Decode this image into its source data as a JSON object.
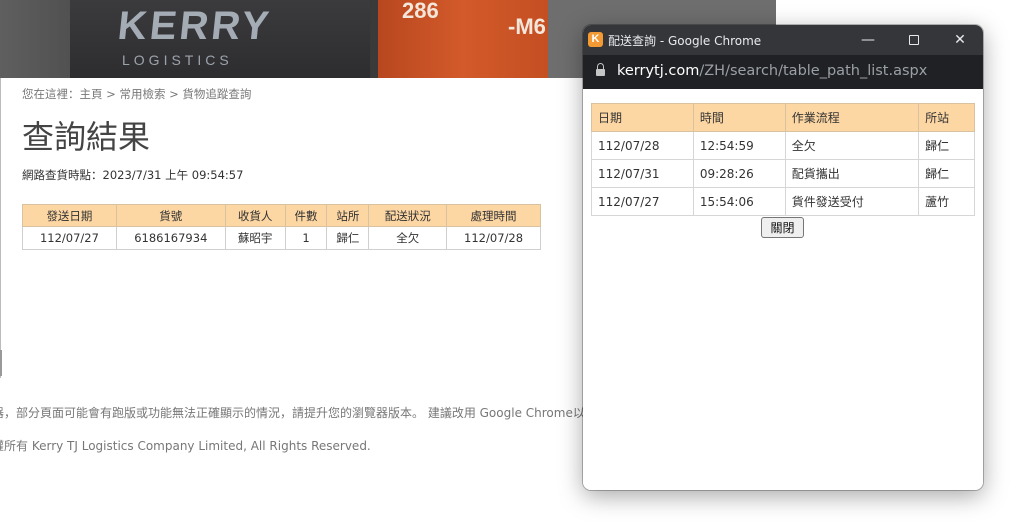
{
  "page": {
    "banner": {
      "brand": "KERRY",
      "brand_sub": "LOGISTICS",
      "num1": "286",
      "num2": "-M6"
    },
    "breadcrumb": "您在這裡：主頁 > 常用檢索 > 貨物追蹤查詢",
    "title": "查詢結果",
    "query_time": "網路查貨時點：2023/7/31 上午 09:54:57",
    "table": {
      "headers": [
        "發送日期",
        "貨號",
        "收貨人",
        "件數",
        "站所",
        "配送狀況",
        "處理時間"
      ],
      "rows": [
        [
          "112/07/27",
          "6186167934",
          "蘇昭宇",
          "1",
          "歸仁",
          "全欠",
          "112/07/28"
        ]
      ]
    },
    "footer_notice": "器，部分頁面可能會有跑版或功能無法正確顯示的情況，請提升您的瀏覽器版本。 建議改用 Google Chrome以",
    "footer_copyright": "權所有 Kerry TJ Logistics Company Limited, All Rights Reserved."
  },
  "popup": {
    "icon_letter": "K",
    "window_title": "配送查詢 - Google Chrome",
    "controls": {
      "minimize": "—",
      "close": "✕"
    },
    "url_domain": "kerrytj.com",
    "url_path": "/ZH/search/table_path_list.aspx",
    "table": {
      "headers": [
        "日期",
        "時間",
        "作業流程",
        "所站"
      ],
      "rows": [
        [
          "112/07/28",
          "12:54:59",
          "全欠",
          "歸仁"
        ],
        [
          "112/07/31",
          "09:28:26",
          "配貨攜出",
          "歸仁"
        ],
        [
          "112/07/27",
          "15:54:06",
          "貨件發送受付",
          "蘆竹"
        ]
      ]
    },
    "close_label": "關閉"
  },
  "colors": {
    "table_header": "#fdd7a3",
    "titlebar": "#35363a",
    "addressbar": "#202124",
    "brand_orange": "#f39a34"
  }
}
